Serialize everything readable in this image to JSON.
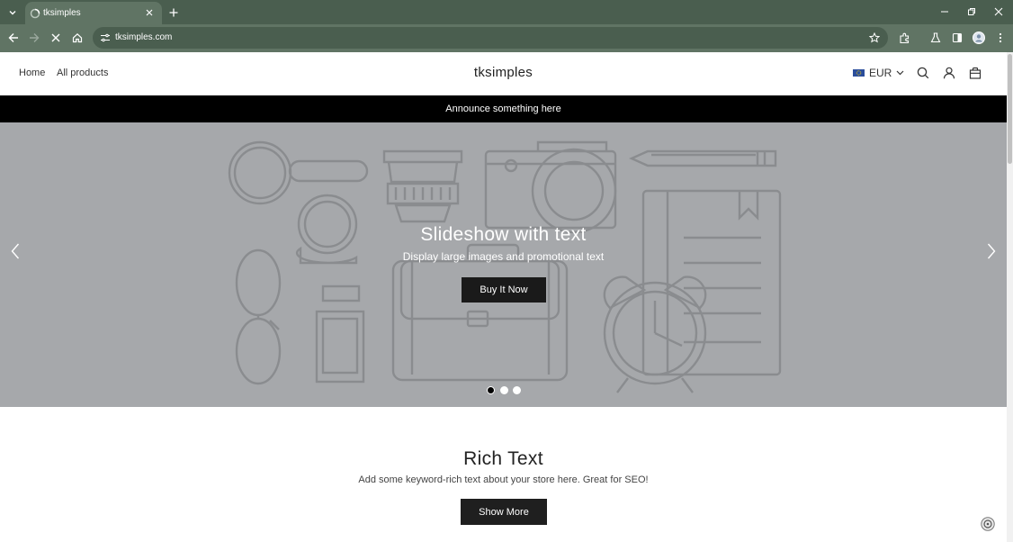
{
  "browser": {
    "tab_title": "tksimples",
    "url": "tksimples.com"
  },
  "header": {
    "nav": [
      "Home",
      "All products"
    ],
    "store_name": "tksimples",
    "currency": "EUR"
  },
  "announcement": "Announce something here",
  "slideshow": {
    "heading": "Slideshow with text",
    "subheading": "Display large images and promotional text",
    "cta": "Buy It Now",
    "active_dot": 1,
    "dot_count": 3
  },
  "rich_text": {
    "title": "Rich Text",
    "body": "Add some keyword-rich text about your store here. Great for SEO!",
    "button": "Show More"
  },
  "colors": {
    "tab_strip": "#4a5e4f",
    "toolbar": "#607464",
    "hero_bg": "#a6a8ab",
    "announce_bg": "#000000"
  }
}
